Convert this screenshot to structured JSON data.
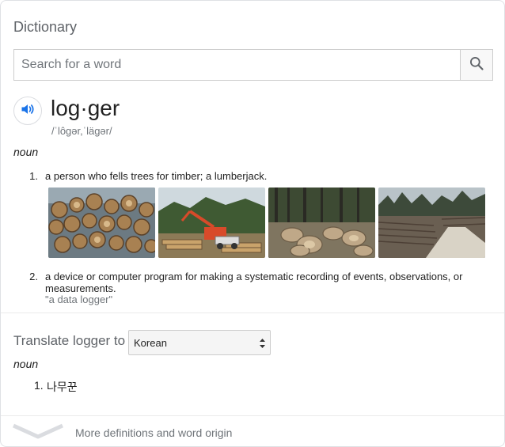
{
  "header": {
    "title": "Dictionary"
  },
  "search": {
    "placeholder": "Search for a word",
    "value": ""
  },
  "entry": {
    "word": "log·ger",
    "pronunciation": "/ˈlôɡər,ˈläɡər/",
    "part_of_speech": "noun",
    "definitions": [
      {
        "number": "1.",
        "text": "a person who fells trees for timber; a lumberjack.",
        "example": ""
      },
      {
        "number": "2.",
        "text": "a device or computer program for making a systematic recording of events, observations, or measurements.",
        "example": "\"a data logger\""
      }
    ]
  },
  "translate": {
    "label": "Translate logger to",
    "language": "Korean",
    "part_of_speech": "noun",
    "results": [
      {
        "number": "1.",
        "text": "나무꾼"
      }
    ]
  },
  "footer": {
    "more_label": "More definitions and word origin"
  },
  "icons": {
    "search": "search-icon",
    "speaker": "speaker-icon",
    "chevron": "chevron-down-icon"
  },
  "colors": {
    "accent": "#1a73e8",
    "muted": "#70757a"
  }
}
